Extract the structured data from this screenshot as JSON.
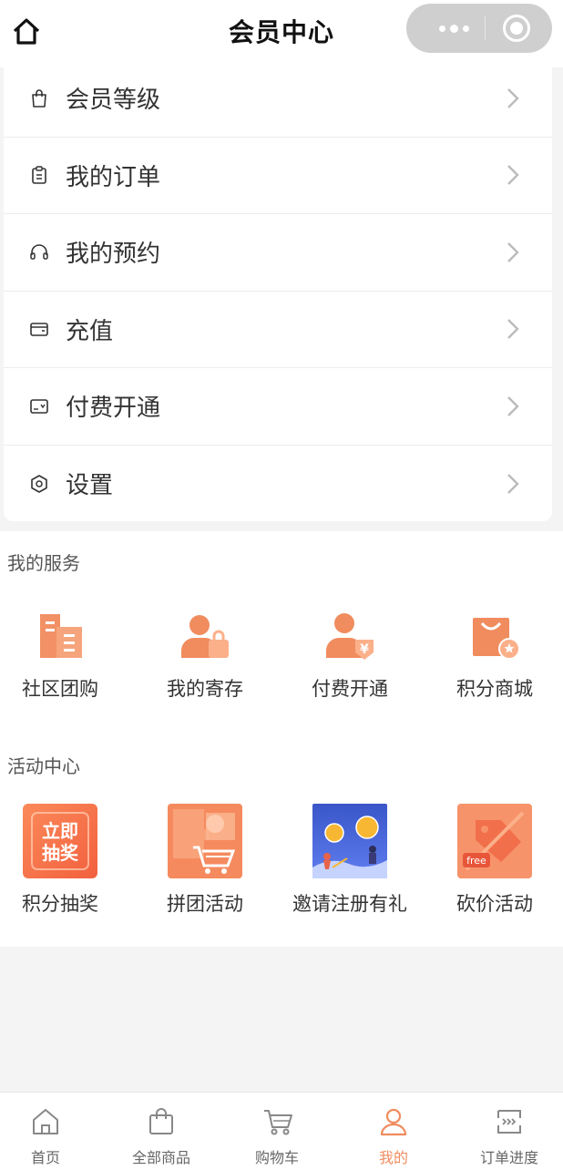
{
  "header": {
    "title": "会员中心"
  },
  "menu": {
    "items": [
      {
        "label": "会员等级",
        "icon": "bag-icon"
      },
      {
        "label": "我的订单",
        "icon": "clipboard-icon"
      },
      {
        "label": "我的预约",
        "icon": "headset-icon"
      },
      {
        "label": "充值",
        "icon": "wallet-icon"
      },
      {
        "label": "付费开通",
        "icon": "card-icon"
      },
      {
        "label": "设置",
        "icon": "hexagon-gear-icon"
      }
    ]
  },
  "services": {
    "title": "我的服务",
    "items": [
      {
        "label": "社区团购",
        "icon": "buildings-icon"
      },
      {
        "label": "我的寄存",
        "icon": "user-bag-icon"
      },
      {
        "label": "付费开通",
        "icon": "user-yen-icon"
      },
      {
        "label": "积分商城",
        "icon": "shopping-bag-star-icon"
      }
    ]
  },
  "activities": {
    "title": "活动中心",
    "items": [
      {
        "label": "积分抽奖",
        "icon": "lottery-tile",
        "tile_text": [
          "立即",
          "抽奖"
        ]
      },
      {
        "label": "拼团活动",
        "icon": "group-cart-tile"
      },
      {
        "label": "邀请注册有礼",
        "icon": "invite-gift-tile"
      },
      {
        "label": "砍价活动",
        "icon": "bargain-tag-tile",
        "tile_text": [
          "free"
        ]
      }
    ]
  },
  "tabbar": {
    "items": [
      {
        "label": "首页",
        "icon": "home-icon",
        "active": false
      },
      {
        "label": "全部商品",
        "icon": "shopping-bag-icon",
        "active": false
      },
      {
        "label": "购物车",
        "icon": "cart-icon",
        "active": false
      },
      {
        "label": "我的",
        "icon": "user-icon",
        "active": true
      },
      {
        "label": "订单进度",
        "icon": "order-progress-icon",
        "active": false
      }
    ]
  },
  "colors": {
    "accent": "#f08c5e",
    "accent_light": "#fbb08a",
    "background": "#f4f4f4"
  }
}
